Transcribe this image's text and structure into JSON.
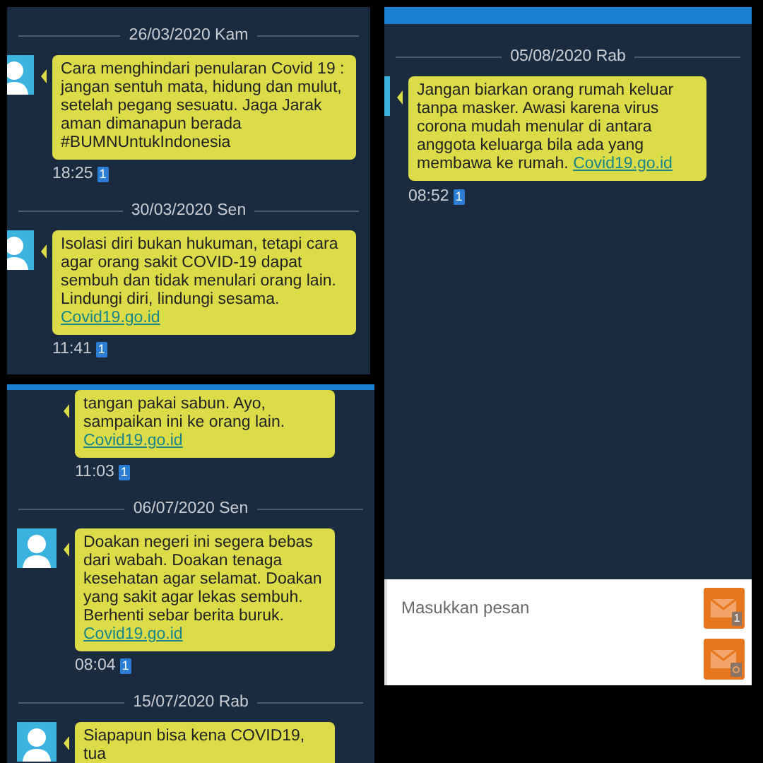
{
  "panels": [
    {
      "header": false,
      "items": [
        {
          "kind": "date",
          "text": "26/03/2020 Kam"
        },
        {
          "kind": "message",
          "avatar": true,
          "text": "Cara menghindari penularan Covid 19 : jangan sentuh mata, hidung dan mulut, setelah pegang sesuatu. Jaga Jarak aman dimanapun berada #BUMNUntukIndonesia",
          "time": "18:25",
          "sim": "1"
        },
        {
          "kind": "date",
          "text": "30/03/2020 Sen"
        },
        {
          "kind": "message",
          "avatar": true,
          "text": "Isolasi diri bukan hukuman, tetapi cara agar orang sakit COVID-19 dapat sembuh dan tidak menulari orang lain. Lindungi diri, lindungi sesama.",
          "link": "Covid19.go.id",
          "time": "11:41",
          "sim": "1"
        }
      ]
    },
    {
      "header": true,
      "items": [
        {
          "kind": "date",
          "text": "05/08/2020 Rab"
        },
        {
          "kind": "message",
          "avatar": true,
          "text": "Jangan biarkan orang rumah keluar tanpa masker. Awasi karena virus corona mudah menular di antara anggota keluarga bila ada yang membawa ke rumah.",
          "link": "Covid19.go.id",
          "time": "08:52",
          "sim": "1"
        }
      ],
      "composer": {
        "placeholder": "Masukkan pesan",
        "send_buttons": [
          {
            "kind": "sim",
            "sim": "1"
          },
          {
            "kind": "any"
          }
        ]
      }
    },
    {
      "header": true,
      "items": [
        {
          "kind": "message",
          "avatar": false,
          "text": "tangan pakai sabun. Ayo, sampaikan ini ke orang lain.",
          "link": "Covid19.go.id",
          "time": "11:03",
          "sim": "1"
        },
        {
          "kind": "date",
          "text": "06/07/2020 Sen"
        },
        {
          "kind": "message",
          "avatar": true,
          "text": "Doakan negeri ini segera bebas dari wabah. Doakan tenaga kesehatan agar selamat. Doakan yang sakit agar lekas sembuh. Berhenti sebar berita buruk.",
          "link": "Covid19.go.id",
          "time": "08:04",
          "sim": "1"
        },
        {
          "kind": "date",
          "text": "15/07/2020 Rab"
        },
        {
          "kind": "message",
          "avatar": true,
          "text": "Siapapun bisa kena COVID19, tua"
        }
      ]
    }
  ]
}
